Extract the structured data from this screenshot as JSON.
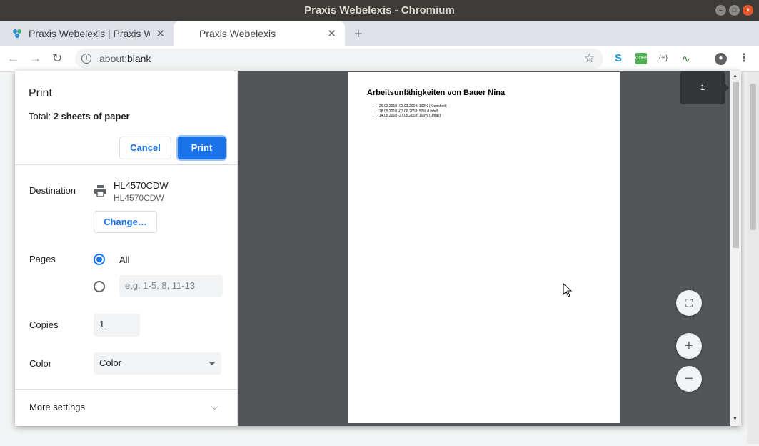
{
  "window": {
    "title": "Praxis Webelexis - Chromium"
  },
  "tabs": [
    {
      "label": "Praxis Webelexis | Praxis Webelexis"
    },
    {
      "label": "Praxis Webelexis"
    }
  ],
  "toolbar": {
    "url_scheme": "about:",
    "url_path": "blank"
  },
  "print_dialog": {
    "title": "Print",
    "total_prefix": "Total: ",
    "total_value": "2 sheets of paper",
    "cancel_label": "Cancel",
    "print_label": "Print",
    "destination": {
      "label": "Destination",
      "name": "HL4570CDW",
      "sub": "HL4570CDW",
      "change_label": "Change…"
    },
    "pages": {
      "label": "Pages",
      "all_label": "All",
      "custom_placeholder": "e.g. 1-5, 8, 11-13",
      "selected": "All"
    },
    "copies": {
      "label": "Copies",
      "value": "1"
    },
    "color": {
      "label": "Color",
      "value": "Color"
    },
    "more_settings_label": "More settings"
  },
  "preview": {
    "page_number": "1",
    "heading": "Arbeitsunfähigkeiten von Bauer Nina",
    "items": [
      "26.02.2019 -03.03.2019: 100% (Krankheit)",
      "28.05.2018 -03.06.2018: 50% (Unfall)",
      "14.05.2018 -27.05.2018: 100% (Unfall)"
    ]
  },
  "colors": {
    "accent": "#1a73e8",
    "preview_bg": "#525659",
    "titlebar": "#3c3b37"
  }
}
